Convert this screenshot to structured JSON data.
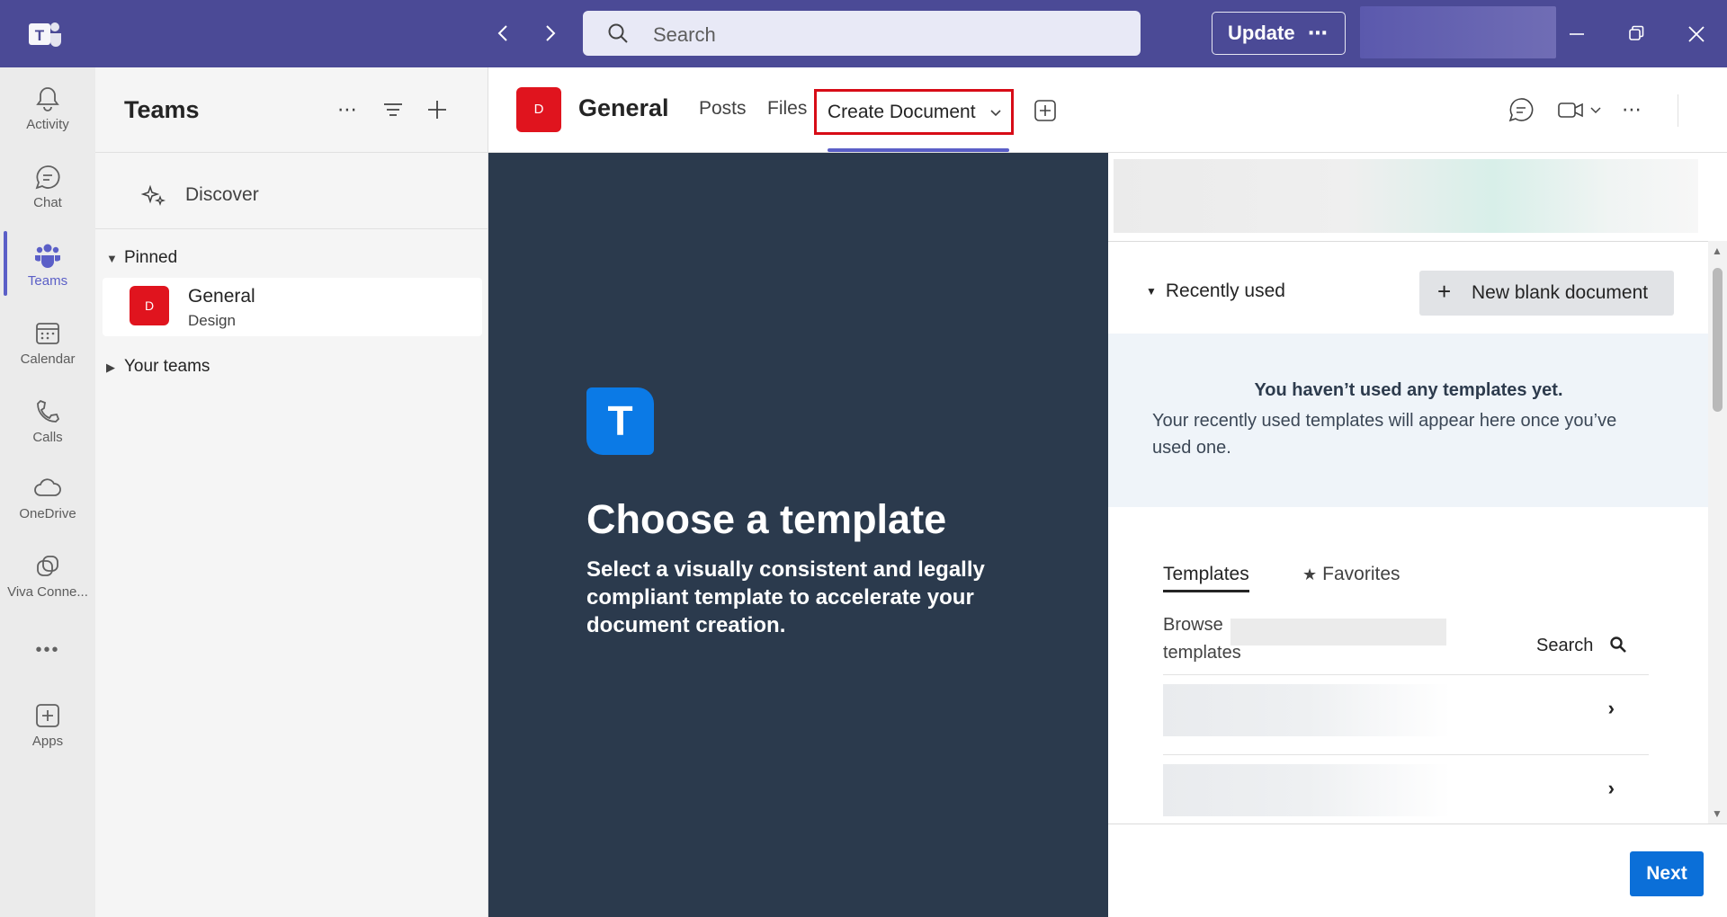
{
  "titlebar": {
    "search_placeholder": "Search",
    "update_label": "Update",
    "update_more": "⋯"
  },
  "rail": {
    "items": [
      {
        "label": "Activity",
        "icon": "bell-icon"
      },
      {
        "label": "Chat",
        "icon": "chat-icon"
      },
      {
        "label": "Teams",
        "icon": "teams-icon",
        "active": true
      },
      {
        "label": "Calendar",
        "icon": "calendar-icon"
      },
      {
        "label": "Calls",
        "icon": "phone-icon"
      },
      {
        "label": "OneDrive",
        "icon": "cloud-icon"
      },
      {
        "label": "Viva Conne...",
        "icon": "viva-connections-icon"
      },
      {
        "label": "Apps",
        "icon": "apps-icon"
      }
    ],
    "more": "•••"
  },
  "panel": {
    "title": "Teams",
    "more": "⋯",
    "discover_label": "Discover",
    "pinned_label": "Pinned",
    "your_teams_label": "Your teams",
    "pinned_team": {
      "avatar_letter": "D",
      "name": "General",
      "team": "Design"
    }
  },
  "channel": {
    "avatar_letter": "D",
    "name": "General",
    "tabs": [
      "Posts",
      "Files",
      "Create Document"
    ],
    "active_tab": "Create Document",
    "more": "⋯"
  },
  "left_pane": {
    "logo_letter": "T",
    "title": "Choose a template",
    "subtitle": "Select a visually consistent and legally compliant template to accelerate your document creation."
  },
  "right_pane": {
    "recently_used_label": "Recently used",
    "new_blank_label": "New blank document",
    "new_blank_icon": "+",
    "empty_title": "You haven’t used any templates yet.",
    "empty_body": "Your recently used templates will appear here once you’ve used one.",
    "tabs": {
      "templates": "Templates",
      "favorites": "Favorites",
      "favorites_icon": "★"
    },
    "browse_label": "Browse templates",
    "search_label": "Search",
    "list_arrow": "›",
    "next_label": "Next"
  },
  "colors": {
    "titlebar": "#4b4a96",
    "accent": "#5b5fc7",
    "team_red": "#e0141e",
    "dark_pane": "#2b3a4d",
    "next_blue": "#0b6fd8",
    "highlight_red": "#d70c17"
  }
}
